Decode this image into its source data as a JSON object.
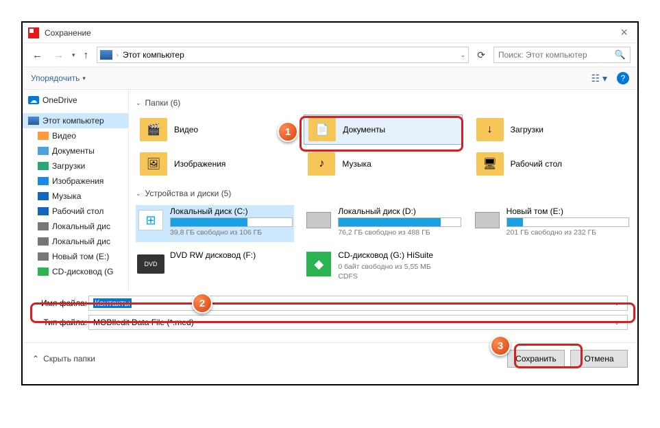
{
  "window": {
    "title": "Сохранение"
  },
  "nav": {
    "path": "Этот компьютер"
  },
  "search": {
    "placeholder": "Поиск: Этот компьютер"
  },
  "toolbar": {
    "organize": "Упорядочить"
  },
  "sidebar": {
    "onedrive": "OneDrive",
    "thispc": "Этот компьютер",
    "items": [
      {
        "label": "Видео",
        "color": "#ff9a3c"
      },
      {
        "label": "Документы",
        "color": "#4aa3df"
      },
      {
        "label": "Загрузки",
        "color": "#2aa86f"
      },
      {
        "label": "Изображения",
        "color": "#1e88e5"
      },
      {
        "label": "Музыка",
        "color": "#1565c0"
      },
      {
        "label": "Рабочий стол",
        "color": "#1565c0"
      },
      {
        "label": "Локальный дис",
        "color": "#777"
      },
      {
        "label": "Локальный дис",
        "color": "#777"
      },
      {
        "label": "Новый том (E:)",
        "color": "#777"
      },
      {
        "label": "CD-дисковод (G",
        "color": "#29b351"
      }
    ]
  },
  "groups": {
    "folders": "Папки (6)",
    "drives": "Устройства и диски (5)"
  },
  "folders": [
    {
      "label": "Видео",
      "glyph": "🎬"
    },
    {
      "label": "Документы",
      "glyph": "📄"
    },
    {
      "label": "Загрузки",
      "glyph": "↓"
    },
    {
      "label": "Изображения",
      "glyph": "🖼"
    },
    {
      "label": "Музыка",
      "glyph": "♪"
    },
    {
      "label": "Рабочий стол",
      "glyph": "🖥"
    }
  ],
  "drives": [
    {
      "name": "Локальный диск (C:)",
      "free": "39,8 ГБ свободно из 106 ГБ",
      "pct": 63,
      "icon": "win",
      "selected": true
    },
    {
      "name": "Локальный диск (D:)",
      "free": "76,2 ГБ свободно из 488 ГБ",
      "pct": 84,
      "icon": "hdd"
    },
    {
      "name": "Новый том (E:)",
      "free": "201 ГБ свободно из 232 ГБ",
      "pct": 13,
      "icon": "hdd"
    },
    {
      "name": "DVD RW дисковод (F:)",
      "free": "",
      "pct": null,
      "icon": "dvd"
    },
    {
      "name": "CD-дисковод (G:) HiSuite",
      "free": "0 байт свободно из 5,55 МБ",
      "sub": "CDFS",
      "pct": null,
      "icon": "hisuite"
    }
  ],
  "filename": {
    "label": "Имя файла:",
    "value": "Контакты"
  },
  "filetype": {
    "label": "Тип файла:",
    "value": "MOBIledit Data File (*.med)"
  },
  "footer": {
    "hide": "Скрыть папки",
    "save": "Сохранить",
    "cancel": "Отмена"
  },
  "callouts": {
    "c1": "1",
    "c2": "2",
    "c3": "3"
  }
}
